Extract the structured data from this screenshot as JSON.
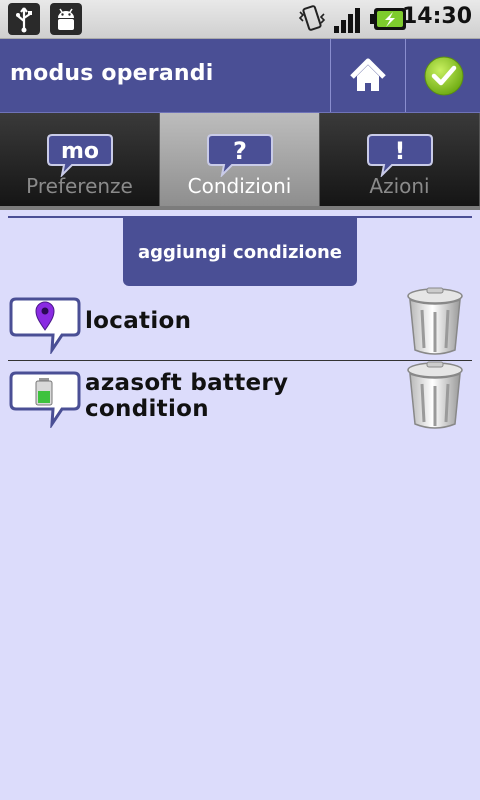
{
  "status_bar": {
    "time": "14:30",
    "icons": [
      "usb-icon",
      "android-debug-icon",
      "vibrate-icon",
      "signal-icon",
      "battery-charging-icon"
    ],
    "colors": {
      "battery": "#7ecb2d"
    }
  },
  "header": {
    "title": "modus operandi",
    "buttons": [
      {
        "name": "home-button",
        "icon": "home-icon"
      },
      {
        "name": "confirm-button",
        "icon": "check-icon"
      }
    ],
    "colors": {
      "bar": "#4a4f95",
      "confirm": "#8acc1c"
    }
  },
  "tabs": [
    {
      "label": "Preferenze",
      "icon": "mo-icon",
      "active": false
    },
    {
      "label": "Condizioni",
      "icon": "question-icon",
      "active": true
    },
    {
      "label": "Azioni",
      "icon": "exclamation-icon",
      "active": false
    }
  ],
  "main": {
    "add_label": "aggiungi condizione",
    "conditions": [
      {
        "label": "location",
        "icon": "location-pin-icon"
      },
      {
        "label_line1": "azasoft battery",
        "label_line2": "condition",
        "icon": "battery-icon"
      }
    ]
  },
  "colors": {
    "background": "#dcdcfb",
    "accent": "#4a4f95"
  }
}
